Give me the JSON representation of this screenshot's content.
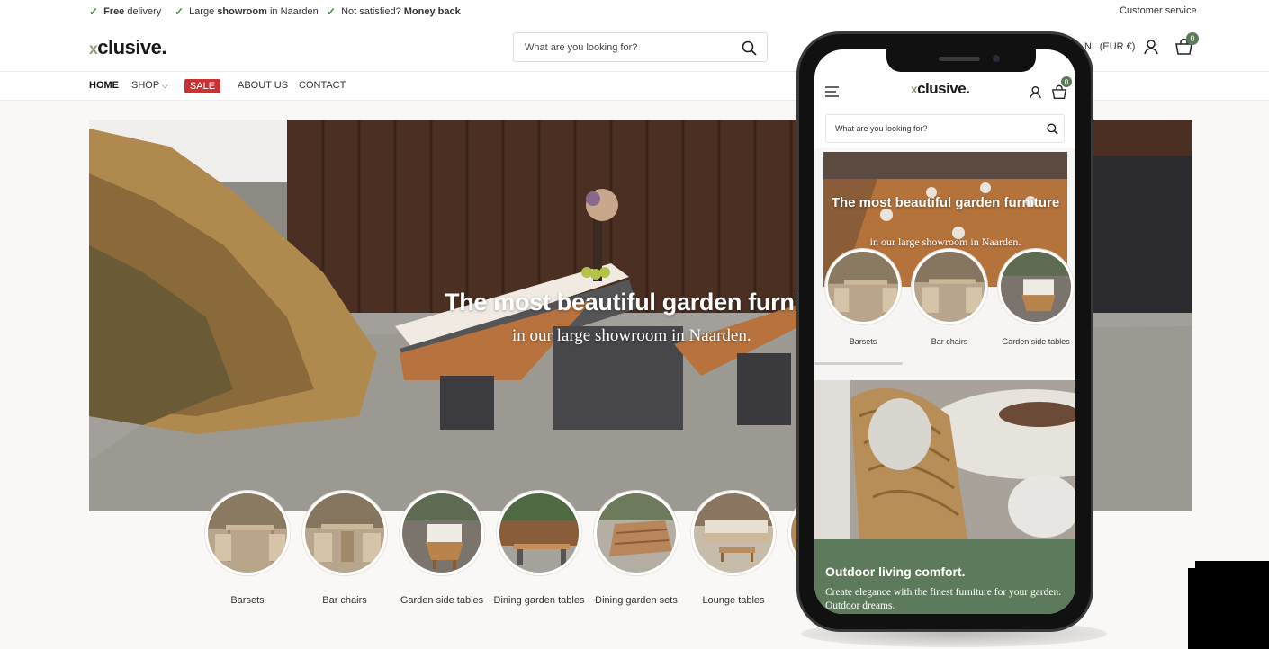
{
  "colors": {
    "accent_green": "#5d7b5c",
    "sale_red": "#c83232",
    "check_green": "#3f8f3f",
    "badge": "#5a7a5a"
  },
  "topbar": {
    "usps": [
      {
        "icon": "check-icon",
        "bold": "Free",
        "text": " delivery"
      },
      {
        "icon": "check-icon",
        "pre": "Large ",
        "bold": "showroom",
        "text": " in Naarden"
      },
      {
        "icon": "check-icon",
        "pre": "Not satisfied? ",
        "bold": "Money back"
      }
    ],
    "customer_service": "Customer service"
  },
  "header": {
    "logo_mark": "x",
    "logo_text": "clusive.",
    "search_placeholder": "What are you looking for?",
    "currency_visible": "NL (EUR €)",
    "cart_count": "0"
  },
  "nav": {
    "items": [
      "HOME",
      "SHOP",
      "SALE",
      "ABOUT US",
      "CONTACT"
    ]
  },
  "hero": {
    "title": "The most beautiful garden furnit",
    "subtitle": "in our large showroom in Naarden."
  },
  "categories": [
    {
      "label": "Barsets"
    },
    {
      "label": "Bar chairs"
    },
    {
      "label": "Garden side tables"
    },
    {
      "label": "Dining garden tables"
    },
    {
      "label": "Dining garden sets"
    },
    {
      "label": "Lounge tables"
    }
  ],
  "mobile": {
    "logo_mark": "x",
    "logo_text": "clusive.",
    "cart_count": "0",
    "search_placeholder": "What are you looking for?",
    "hero_title": "The most beautiful garden furniture",
    "hero_subtitle": "in our large showroom in Naarden.",
    "categories": [
      {
        "label": "Barsets"
      },
      {
        "label": "Bar chairs"
      },
      {
        "label": "Garden side tables"
      }
    ],
    "promo_title": "Outdoor living comfort.",
    "promo_text": "Create elegance with the finest furniture for your garden. Outdoor dreams."
  }
}
